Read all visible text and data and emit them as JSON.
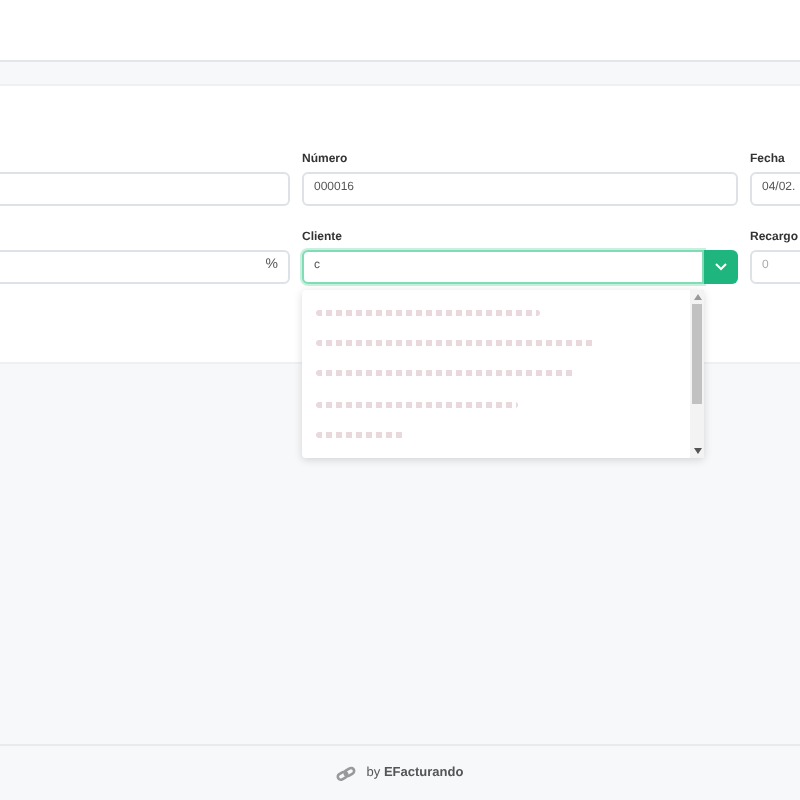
{
  "form": {
    "fields": [
      {
        "kind": "text"
      },
      {
        "kind": "text",
        "label": "Número",
        "value": "000016"
      },
      {
        "kind": "text",
        "label": "Fecha",
        "value": "04/02."
      },
      {
        "kind": "percent",
        "suffix": "%"
      },
      {
        "kind": "select",
        "label": "Cliente",
        "value": "c",
        "focused": true,
        "expanded": true
      },
      {
        "kind": "text",
        "label": "Recargo",
        "placeholder": "0"
      }
    ]
  },
  "dropdown": {
    "options": [
      {
        "kind": "blurred"
      },
      {
        "kind": "blurred"
      },
      {
        "kind": "blurred"
      },
      {
        "kind": "blurred"
      },
      {
        "kind": "blurred"
      }
    ]
  },
  "footer": {
    "text": "by **EFacturando**"
  }
}
